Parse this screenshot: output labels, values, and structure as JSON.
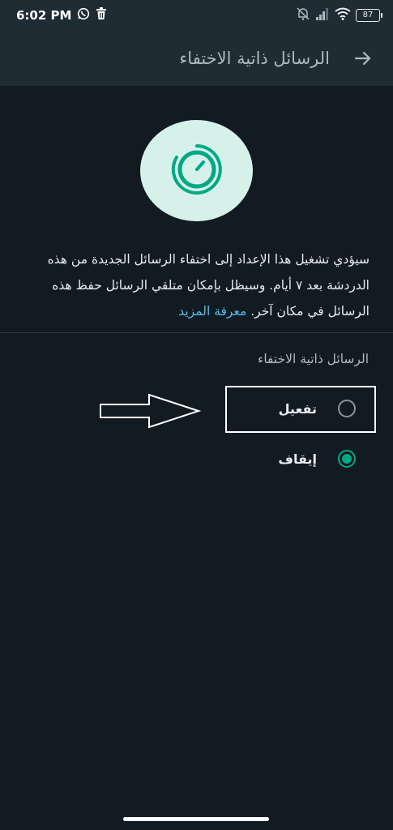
{
  "status_bar": {
    "time": "6:02 PM",
    "battery": "87",
    "icons": [
      "whatsapp-icon",
      "trash-icon",
      "mute-icon",
      "signal-icon",
      "wifi-icon",
      "battery-icon"
    ]
  },
  "app_bar": {
    "title": "الرسائل ذاتية الاختفاء",
    "back_icon": "arrow-right-icon"
  },
  "illustration": {
    "icon": "timer-icon",
    "bg_color": "#d6f1ea",
    "accent_color": "#00a884"
  },
  "description": {
    "text": "سيؤدي تشغيل هذا الإعداد إلى اختفاء الرسائل الجديدة من هذه الدردشة بعد ٧ أيام. وسيظل بإمكان متلقي الرسائل حفظ هذه الرسائل في مكان آخر.",
    "link": "معرفة المزيد"
  },
  "section": {
    "title": "الرسائل ذاتية الاختفاء",
    "options": [
      {
        "label": "تفعيل",
        "selected": false
      },
      {
        "label": "إيقاف",
        "selected": true
      }
    ]
  },
  "colors": {
    "background": "#121b22",
    "appbar": "#1f2c34",
    "accent": "#00a884",
    "link": "#53bdeb"
  }
}
